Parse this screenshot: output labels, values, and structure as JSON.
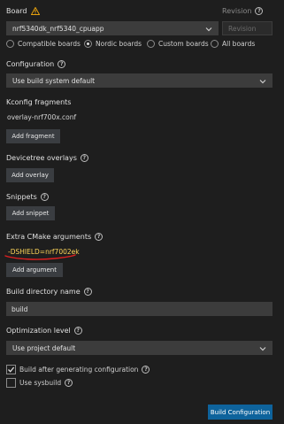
{
  "board": {
    "label": "Board",
    "value": "nrf5340dk_nrf5340_cpuapp",
    "options": [
      "Compatible boards",
      "Nordic boards",
      "Custom boards",
      "All boards"
    ],
    "selected_option": "Nordic boards"
  },
  "revision": {
    "label": "Revision",
    "placeholder": "Revision"
  },
  "configuration": {
    "label": "Configuration",
    "value": "Use build system default"
  },
  "kconfig": {
    "label": "Kconfig fragments",
    "fragment": "overlay-nrf700x.conf",
    "add_label": "Add fragment"
  },
  "devicetree": {
    "label": "Devicetree overlays",
    "add_label": "Add overlay"
  },
  "snippets": {
    "label": "Snippets",
    "add_label": "Add snippet"
  },
  "cmake": {
    "label": "Extra CMake arguments",
    "argument": "-DSHIELD=nrf7002ek",
    "add_label": "Add argument"
  },
  "build_dir": {
    "label": "Build directory name",
    "value": "build"
  },
  "optimization": {
    "label": "Optimization level",
    "value": "Use project default"
  },
  "options": {
    "build_after": "Build after generating configuration",
    "build_after_checked": true,
    "sysbuild": "Use sysbuild",
    "sysbuild_checked": false
  },
  "action": {
    "label": "Build Configuration"
  },
  "colors": {
    "background": "#1e1e1e",
    "accent": "#0e639c",
    "warning": "#e5a00d",
    "annotation": "#e02020",
    "cmake_text": "#ffd659"
  }
}
